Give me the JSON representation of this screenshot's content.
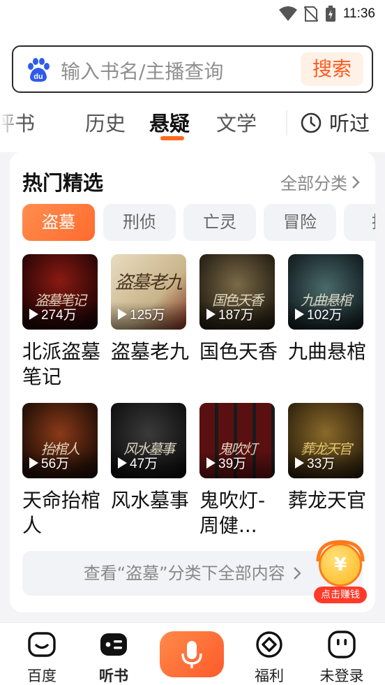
{
  "status_bar": {
    "time": "11:36"
  },
  "search": {
    "placeholder": "输入书名/主播查询",
    "button_label": "搜索"
  },
  "category_tabs": [
    {
      "label": "评书"
    },
    {
      "label": "历史"
    },
    {
      "label": "悬疑",
      "active": true
    },
    {
      "label": "文学"
    }
  ],
  "history_label": "听过",
  "section": {
    "title": "热门精选",
    "all_label": "全部分类"
  },
  "sub_tags": [
    {
      "label": "盗墓",
      "active": true
    },
    {
      "label": "刑侦"
    },
    {
      "label": "亡灵"
    },
    {
      "label": "冒险"
    },
    {
      "label": "推"
    }
  ],
  "books": [
    {
      "title": "北派盗墓笔记",
      "plays": "274万",
      "cover_text": "盗墓笔记"
    },
    {
      "title": "盗墓老九",
      "plays": "125万",
      "cover_text": "盗墓老九"
    },
    {
      "title": "国色天香",
      "plays": "187万",
      "cover_text": "国色天香"
    },
    {
      "title": "九曲悬棺",
      "plays": "102万",
      "cover_text": "九曲悬棺"
    },
    {
      "title": "天命抬棺人",
      "plays": "56万",
      "cover_text": "抬棺人"
    },
    {
      "title": "风水墓事",
      "plays": "47万",
      "cover_text": "风水墓事"
    },
    {
      "title": "鬼吹灯-周健...",
      "plays": "39万",
      "cover_text": "鬼吹灯"
    },
    {
      "title": "葬龙天官",
      "plays": "33万",
      "cover_text": "葬龙天官"
    }
  ],
  "more_link": "查看“盗墓”分类下全部内容",
  "earn_badge": {
    "symbol": "¥",
    "label": "点击赚钱"
  },
  "bottom_nav": [
    {
      "label": "百度"
    },
    {
      "label": "听书",
      "active": true
    },
    {
      "label": "福利"
    },
    {
      "label": "未登录"
    }
  ],
  "colors": {
    "accent": "#ff6a1f",
    "search_accent": "#ff5a1f",
    "brand_blue": "#2f5bea"
  }
}
